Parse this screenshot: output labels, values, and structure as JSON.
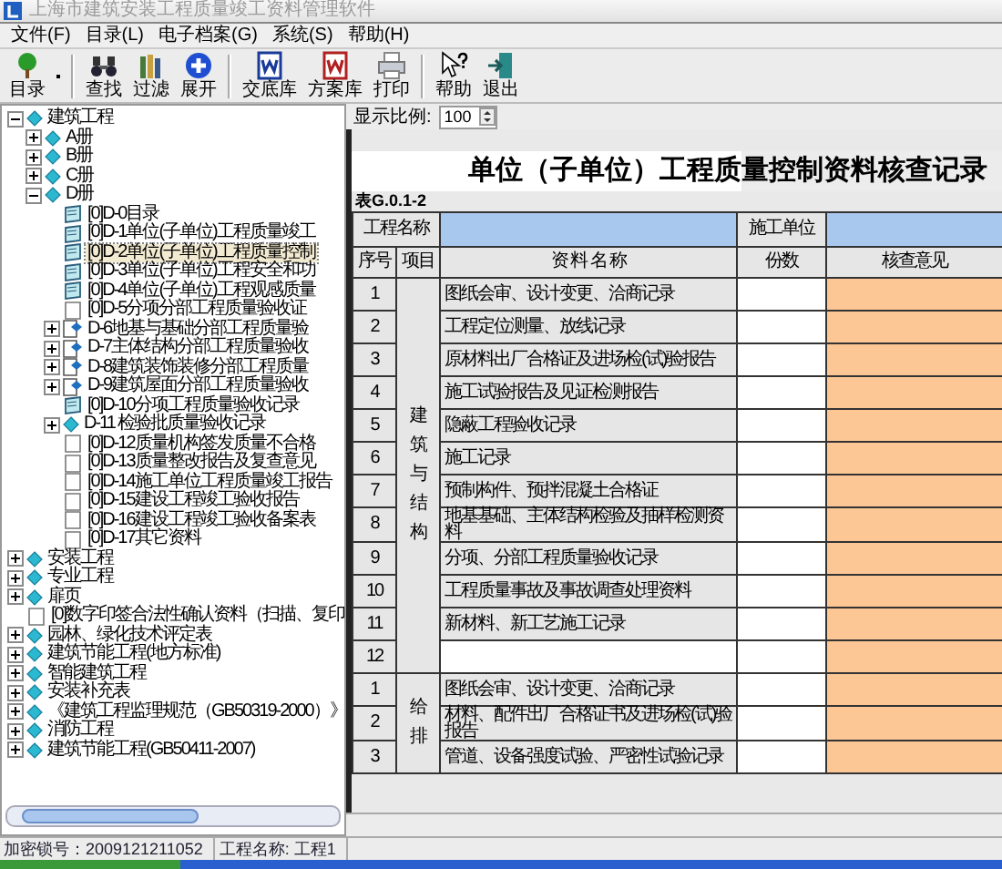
{
  "window": {
    "title": "上海市建筑安装工程质量竣工资料管理软件"
  },
  "menu": [
    "文件(F)",
    "目录(L)",
    "电子档案(G)",
    "系统(S)",
    "帮助(H)"
  ],
  "toolbar": [
    {
      "label": "目录"
    },
    {
      "label": "查找"
    },
    {
      "label": "过滤"
    },
    {
      "label": "展开"
    },
    {
      "label": "交底库"
    },
    {
      "label": "方案库"
    },
    {
      "label": "打印"
    },
    {
      "label": "帮助"
    },
    {
      "label": "退出"
    }
  ],
  "tree": [
    {
      "label": "建筑工程",
      "kind": "folder",
      "expanded": true,
      "selected": false,
      "children": [
        {
          "label": "A册",
          "kind": "folder",
          "expanded": false,
          "selected": false
        },
        {
          "label": "B册",
          "kind": "folder",
          "expanded": false,
          "selected": false
        },
        {
          "label": "C册",
          "kind": "folder",
          "expanded": false,
          "selected": false
        },
        {
          "label": "D册",
          "kind": "folder",
          "expanded": true,
          "selected": false,
          "children": [
            {
              "label": "[0]D-0目录",
              "kind": "doc",
              "selected": false
            },
            {
              "label": "[0]D-1单位(子单位)工程质量竣工",
              "kind": "doc",
              "selected": false
            },
            {
              "label": "[0]D-2单位(子单位)工程质量控制",
              "kind": "doc",
              "selected": true
            },
            {
              "label": "[0]D-3单位(子单位)工程安全和功",
              "kind": "doc",
              "selected": false
            },
            {
              "label": "[0]D-4单位(子单位)工程观感质量",
              "kind": "doc",
              "selected": false
            },
            {
              "label": "[0]D-5分项分部工程质量验收证",
              "kind": "page",
              "selected": false
            },
            {
              "label": "D-6地基与基础分部工程质量验",
              "kind": "record",
              "expanded": false,
              "selected": false
            },
            {
              "label": "D-7主体结构分部工程质量验收",
              "kind": "record",
              "expanded": false,
              "selected": false
            },
            {
              "label": "D-8建筑装饰装修分部工程质量",
              "kind": "record",
              "expanded": false,
              "selected": false
            },
            {
              "label": "D-9建筑屋面分部工程质量验收",
              "kind": "record",
              "expanded": false,
              "selected": false
            },
            {
              "label": "[0]D-10分项工程质量验收记录",
              "kind": "doc",
              "selected": false
            },
            {
              "label": "D-11 检验批质量验收记录",
              "kind": "folder",
              "expanded": false,
              "selected": false
            },
            {
              "label": "[0]D-12质量机构签发质量不合格",
              "kind": "page",
              "selected": false
            },
            {
              "label": "[0]D-13质量整改报告及复查意见",
              "kind": "page",
              "selected": false
            },
            {
              "label": "[0]D-14施工单位工程质量竣工报告",
              "kind": "page",
              "selected": false
            },
            {
              "label": "[0]D-15建设工程竣工验收报告",
              "kind": "page",
              "selected": false
            },
            {
              "label": "[0]D-16建设工程竣工验收备案表",
              "kind": "page",
              "selected": false
            },
            {
              "label": "[0]D-17其它资料",
              "kind": "page",
              "selected": false
            }
          ]
        }
      ]
    },
    {
      "label": "安装工程",
      "kind": "folder",
      "expanded": false,
      "selected": false
    },
    {
      "label": "专业工程",
      "kind": "folder",
      "expanded": false,
      "selected": false
    },
    {
      "label": "扉页",
      "kind": "folder",
      "expanded": false,
      "selected": false
    },
    {
      "label": "[0]数字印签合法性确认资料（扫描、复印",
      "kind": "page",
      "selected": false
    },
    {
      "label": "园林、绿化技术评定表",
      "kind": "folder",
      "expanded": false,
      "selected": false
    },
    {
      "label": "建筑节能工程(地方标准)",
      "kind": "folder",
      "expanded": false,
      "selected": false
    },
    {
      "label": "智能建筑工程",
      "kind": "folder",
      "expanded": false,
      "selected": false
    },
    {
      "label": "安装补充表",
      "kind": "folder",
      "expanded": false,
      "selected": false
    },
    {
      "label": "《建筑工程监理规范（GB50319-2000）》",
      "kind": "folder",
      "expanded": false,
      "selected": false
    },
    {
      "label": "消防工程",
      "kind": "folder",
      "expanded": false,
      "selected": false
    },
    {
      "label": "建筑节能工程(GB50411-2007)",
      "kind": "folder",
      "expanded": false,
      "selected": false
    }
  ],
  "zoom": {
    "label": "显示比例:",
    "value": "100"
  },
  "document": {
    "title": "单位（子单位）工程质量控制资料核查记录",
    "form_no": "表G.0.1-2",
    "project_label": "工程名称",
    "contractor_label": "施工单位",
    "columns": [
      "序号",
      "项目",
      "资 料 名 称",
      "份数",
      "核查意见"
    ],
    "sections": [
      {
        "item": "建筑与结构",
        "rows": [
          {
            "no": "1",
            "name": "图纸会审、设计变更、洽商记录"
          },
          {
            "no": "2",
            "name": "工程定位测量、放线记录"
          },
          {
            "no": "3",
            "name": "原材料出厂合格证及进场检(试)验报告"
          },
          {
            "no": "4",
            "name": "施工试验报告及见证检测报告"
          },
          {
            "no": "5",
            "name": "隐蔽工程验收记录"
          },
          {
            "no": "6",
            "name": "施工记录"
          },
          {
            "no": "7",
            "name": "预制构件、预拌混凝土合格证"
          },
          {
            "no": "8",
            "name": "地基基础、主体结构检验及抽样检测资料"
          },
          {
            "no": "9",
            "name": "分项、分部工程质量验收记录"
          },
          {
            "no": "10",
            "name": "工程质量事故及事故调查处理资料"
          },
          {
            "no": "11",
            "name": "新材料、新工艺施工记录"
          },
          {
            "no": "12"
          }
        ]
      },
      {
        "item": "给排",
        "rows": [
          {
            "no": "1",
            "name": "图纸会审、设计变更、洽商记录"
          },
          {
            "no": "2",
            "name": "材料、配件出厂合格证书及进场检(试)验报告"
          },
          {
            "no": "3",
            "name": "管道、设备强度试验、严密性试验记录"
          }
        ]
      }
    ]
  },
  "status_bar": [
    "加密锁号：2009121211052",
    "工程名称: 工程1"
  ]
}
